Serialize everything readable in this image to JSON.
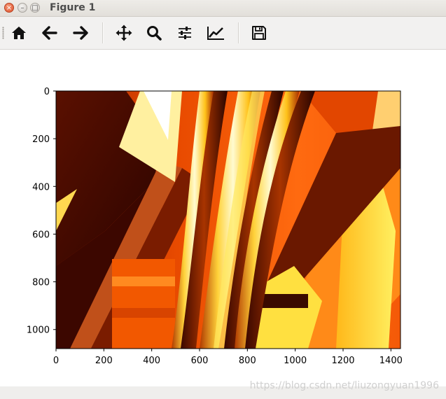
{
  "window": {
    "title": "Figure 1",
    "close_glyph": "×",
    "min_glyph": "–",
    "max_glyph": "□"
  },
  "toolbar": {
    "buttons": [
      {
        "name": "home-icon",
        "label": "Home"
      },
      {
        "name": "back-arrow-icon",
        "label": "Back"
      },
      {
        "name": "forward-arrow-icon",
        "label": "Forward"
      },
      {
        "name": "pan-move-icon",
        "label": "Pan"
      },
      {
        "name": "zoom-magnifier-icon",
        "label": "Zoom"
      },
      {
        "name": "subplots-sliders-icon",
        "label": "Subplots"
      },
      {
        "name": "edit-axes-chart-icon",
        "label": "Customize"
      },
      {
        "name": "save-floppy-icon",
        "label": "Save"
      }
    ]
  },
  "chart_data": {
    "type": "image",
    "xlim": [
      0,
      1440
    ],
    "ylim": [
      1080,
      0
    ],
    "xticks": [
      0,
      200,
      400,
      600,
      800,
      1000,
      1200,
      1400
    ],
    "yticks": [
      0,
      200,
      400,
      600,
      800,
      1000
    ],
    "xtick_labels": [
      "0",
      "200",
      "400",
      "600",
      "800",
      "1000",
      "1200",
      "1400"
    ],
    "ytick_labels": [
      "0",
      "200",
      "400",
      "600",
      "800",
      "1000"
    ],
    "colormap": "hot"
  },
  "watermark": "https://blog.csdn.net/liuzongyuan1996"
}
